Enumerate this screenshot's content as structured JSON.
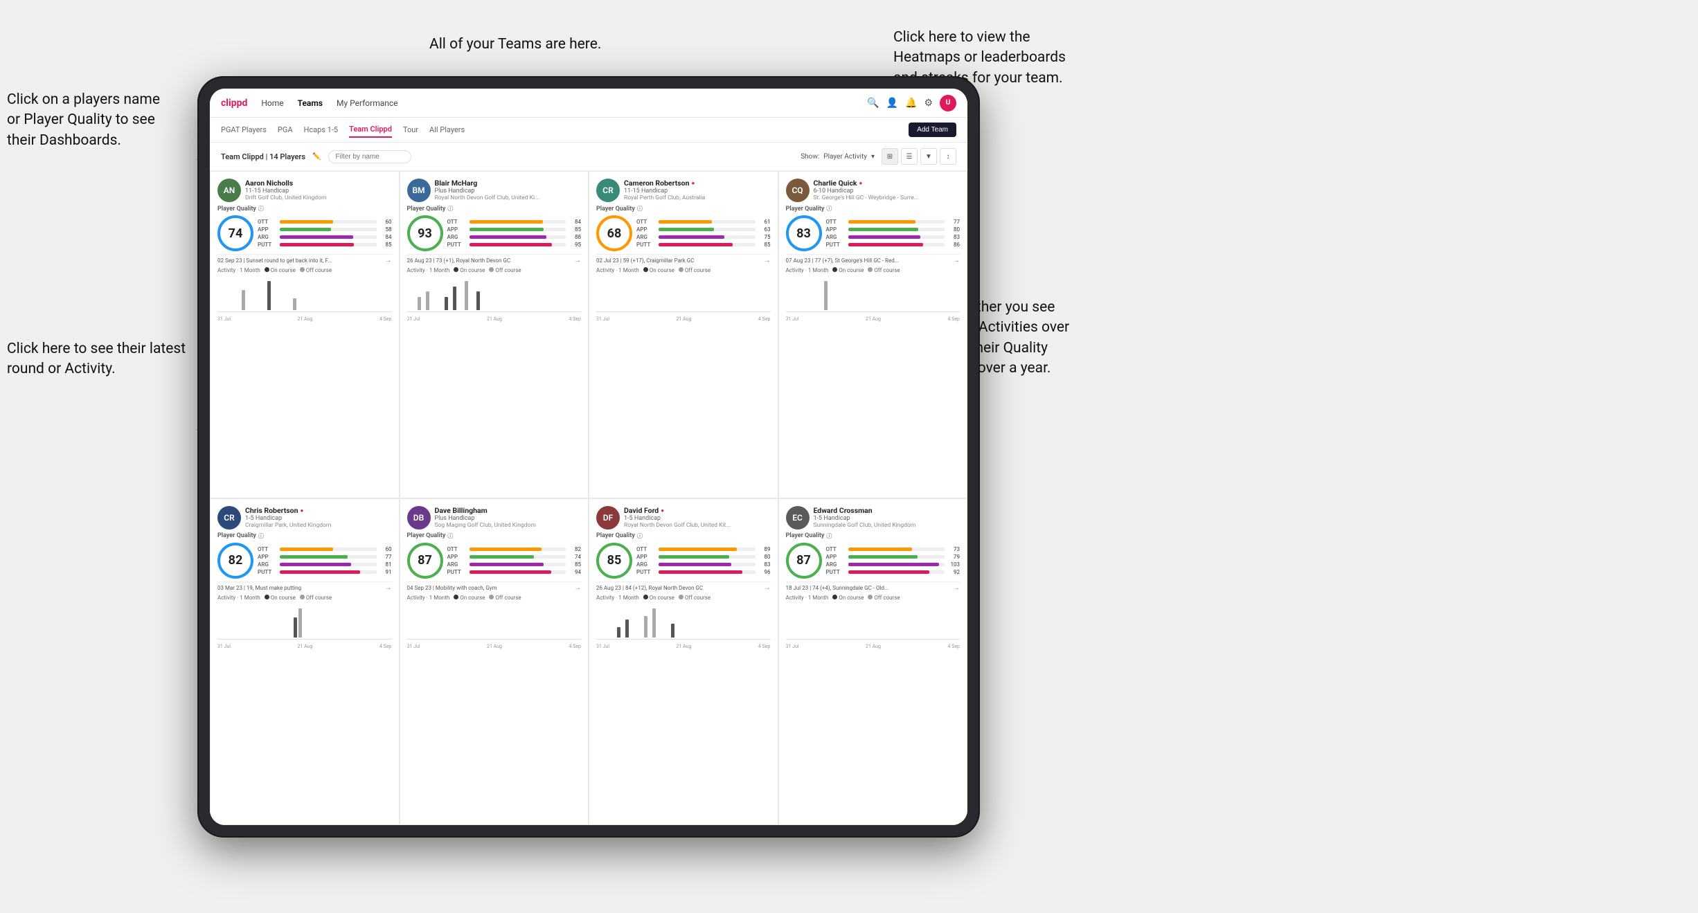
{
  "annotations": {
    "teams_callout": "All of your Teams are here.",
    "heatmaps_callout": "Click here to view the\nHeatmaps or leaderboards\nand streaks for your team.",
    "player_name_callout": "Click on a players name\nor Player Quality to see\ntheir Dashboards.",
    "latest_round_callout": "Click here to see their latest\nround or Activity.",
    "activities_callout": "Choose whether you see\nyour players Activities over\na month or their Quality\nScore Trend over a year."
  },
  "nav": {
    "logo": "clippd",
    "items": [
      "Home",
      "Teams",
      "My Performance"
    ],
    "active": "Teams",
    "icons": [
      "search",
      "person",
      "bell",
      "settings",
      "avatar"
    ]
  },
  "sub_nav": {
    "items": [
      "PGAT Players",
      "PGA",
      "Hcaps 1-5",
      "Team Clippd",
      "Tour",
      "All Players"
    ],
    "active": "Team Clippd",
    "add_team_label": "Add Team"
  },
  "team_header": {
    "title": "Team Clippd | 14 Players",
    "filter_placeholder": "Filter by name",
    "show_label": "Show:",
    "show_value": "Player Activity"
  },
  "players": [
    {
      "name": "Aaron Nicholls",
      "handicap": "11-15 Handicap",
      "club": "Drift Golf Club, United Kingdom",
      "quality": 74,
      "quality_color": "blue",
      "ott": 60,
      "app": 58,
      "arg": 84,
      "putt": 85,
      "latest_date": "02 Sep 23",
      "latest_text": "Sunset round to get back into it, F...",
      "avatar_color": "av-green",
      "avatar_initials": "AN",
      "chart_bars": [
        0,
        0,
        0,
        0,
        0,
        0,
        0,
        2,
        0,
        0,
        0,
        0,
        0,
        0,
        3,
        0,
        0,
        0,
        0,
        0,
        0,
        1,
        0,
        0
      ]
    },
    {
      "name": "Blair McHarg",
      "handicap": "Plus Handicap",
      "club": "Royal North Devon Golf Club, United Ki...",
      "quality": 93,
      "quality_color": "green",
      "ott": 84,
      "app": 85,
      "arg": 88,
      "putt": 95,
      "latest_date": "26 Aug 23",
      "latest_text": "73 (+1), Royal North Devon GC",
      "avatar_color": "av-blue",
      "avatar_initials": "BM",
      "chart_bars": [
        0,
        0,
        0,
        2,
        0,
        3,
        0,
        0,
        0,
        0,
        2,
        0,
        4,
        0,
        0,
        5,
        0,
        0,
        3,
        0,
        0,
        0,
        0,
        0
      ]
    },
    {
      "name": "Cameron Robertson",
      "verified": true,
      "handicap": "11-15 Handicap",
      "club": "Royal Perth Golf Club, Australia",
      "quality": 68,
      "quality_color": "orange",
      "ott": 61,
      "app": 63,
      "arg": 75,
      "putt": 85,
      "latest_date": "02 Jul 23",
      "latest_text": "59 (+17), Craigmillar Park GC",
      "avatar_color": "av-teal",
      "avatar_initials": "CR",
      "chart_bars": [
        0,
        0,
        0,
        0,
        0,
        0,
        0,
        0,
        0,
        0,
        0,
        0,
        0,
        0,
        0,
        0,
        0,
        0,
        0,
        0,
        0,
        0,
        0,
        0
      ]
    },
    {
      "name": "Charlie Quick",
      "verified": true,
      "handicap": "6-10 Handicap",
      "club": "St. George's Hill GC - Weybridge - Surre...",
      "quality": 83,
      "quality_color": "blue",
      "ott": 77,
      "app": 80,
      "arg": 83,
      "putt": 86,
      "latest_date": "07 Aug 23",
      "latest_text": "77 (+7), St George's Hill GC - Red...",
      "avatar_color": "av-brown",
      "avatar_initials": "CQ",
      "chart_bars": [
        0,
        0,
        0,
        0,
        0,
        0,
        0,
        0,
        0,
        0,
        0,
        2,
        0,
        0,
        0,
        0,
        0,
        0,
        0,
        0,
        0,
        0,
        0,
        0
      ]
    },
    {
      "name": "Chris Robertson",
      "verified": true,
      "handicap": "1-5 Handicap",
      "club": "Craigmillar Park, United Kingdom",
      "quality": 82,
      "quality_color": "blue",
      "ott": 60,
      "app": 77,
      "arg": 81,
      "putt": 91,
      "latest_date": "03 Mar 23",
      "latest_text": "19, Must make putting",
      "avatar_color": "av-navy",
      "avatar_initials": "CR",
      "chart_bars": [
        0,
        0,
        0,
        0,
        0,
        0,
        0,
        0,
        0,
        0,
        0,
        0,
        0,
        0,
        0,
        0,
        0,
        0,
        0,
        0,
        0,
        0,
        2,
        3
      ]
    },
    {
      "name": "Dave Billingham",
      "verified": false,
      "handicap": "Plus Handicap",
      "club": "Sog Maging Golf Club, United Kingdom",
      "quality": 87,
      "quality_color": "green",
      "ott": 82,
      "app": 74,
      "arg": 85,
      "putt": 94,
      "latest_date": "04 Sep 23",
      "latest_text": "Mobility with coach, Gym",
      "avatar_color": "av-purple",
      "avatar_initials": "DB",
      "chart_bars": [
        0,
        0,
        0,
        0,
        0,
        0,
        0,
        0,
        0,
        0,
        0,
        0,
        0,
        0,
        0,
        0,
        0,
        0,
        0,
        0,
        0,
        0,
        0,
        0
      ]
    },
    {
      "name": "David Ford",
      "verified": true,
      "handicap": "1-5 Handicap",
      "club": "Royal North Devon Golf Club, United Kit...",
      "quality": 85,
      "quality_color": "green",
      "ott": 89,
      "app": 80,
      "arg": 83,
      "putt": 96,
      "latest_date": "26 Aug 23",
      "latest_text": "84 (+12), Royal North Devon GC",
      "avatar_color": "av-red",
      "avatar_initials": "DF",
      "chart_bars": [
        0,
        0,
        0,
        0,
        0,
        0,
        2,
        0,
        4,
        0,
        0,
        0,
        0,
        5,
        0,
        7,
        0,
        0,
        0,
        0,
        3,
        0,
        0,
        0
      ]
    },
    {
      "name": "Edward Crossman",
      "verified": false,
      "handicap": "1-5 Handicap",
      "club": "Sunningdale Golf Club, United Kingdom",
      "quality": 87,
      "quality_color": "green",
      "ott": 73,
      "app": 79,
      "arg": 103,
      "putt": 92,
      "latest_date": "18 Jul 23",
      "latest_text": "74 (+4), Sunningdale GC - Old...",
      "avatar_color": "av-gray",
      "avatar_initials": "EC",
      "chart_bars": [
        0,
        0,
        0,
        0,
        0,
        0,
        0,
        0,
        0,
        0,
        0,
        0,
        0,
        0,
        0,
        0,
        0,
        0,
        0,
        0,
        0,
        0,
        0,
        0
      ]
    }
  ],
  "chart_dates_row1": [
    "31 Jul",
    "21 Aug",
    "4 Sep"
  ],
  "chart_dates_row2": [
    "31 Jul",
    "21 Aug",
    "4 Sep"
  ]
}
